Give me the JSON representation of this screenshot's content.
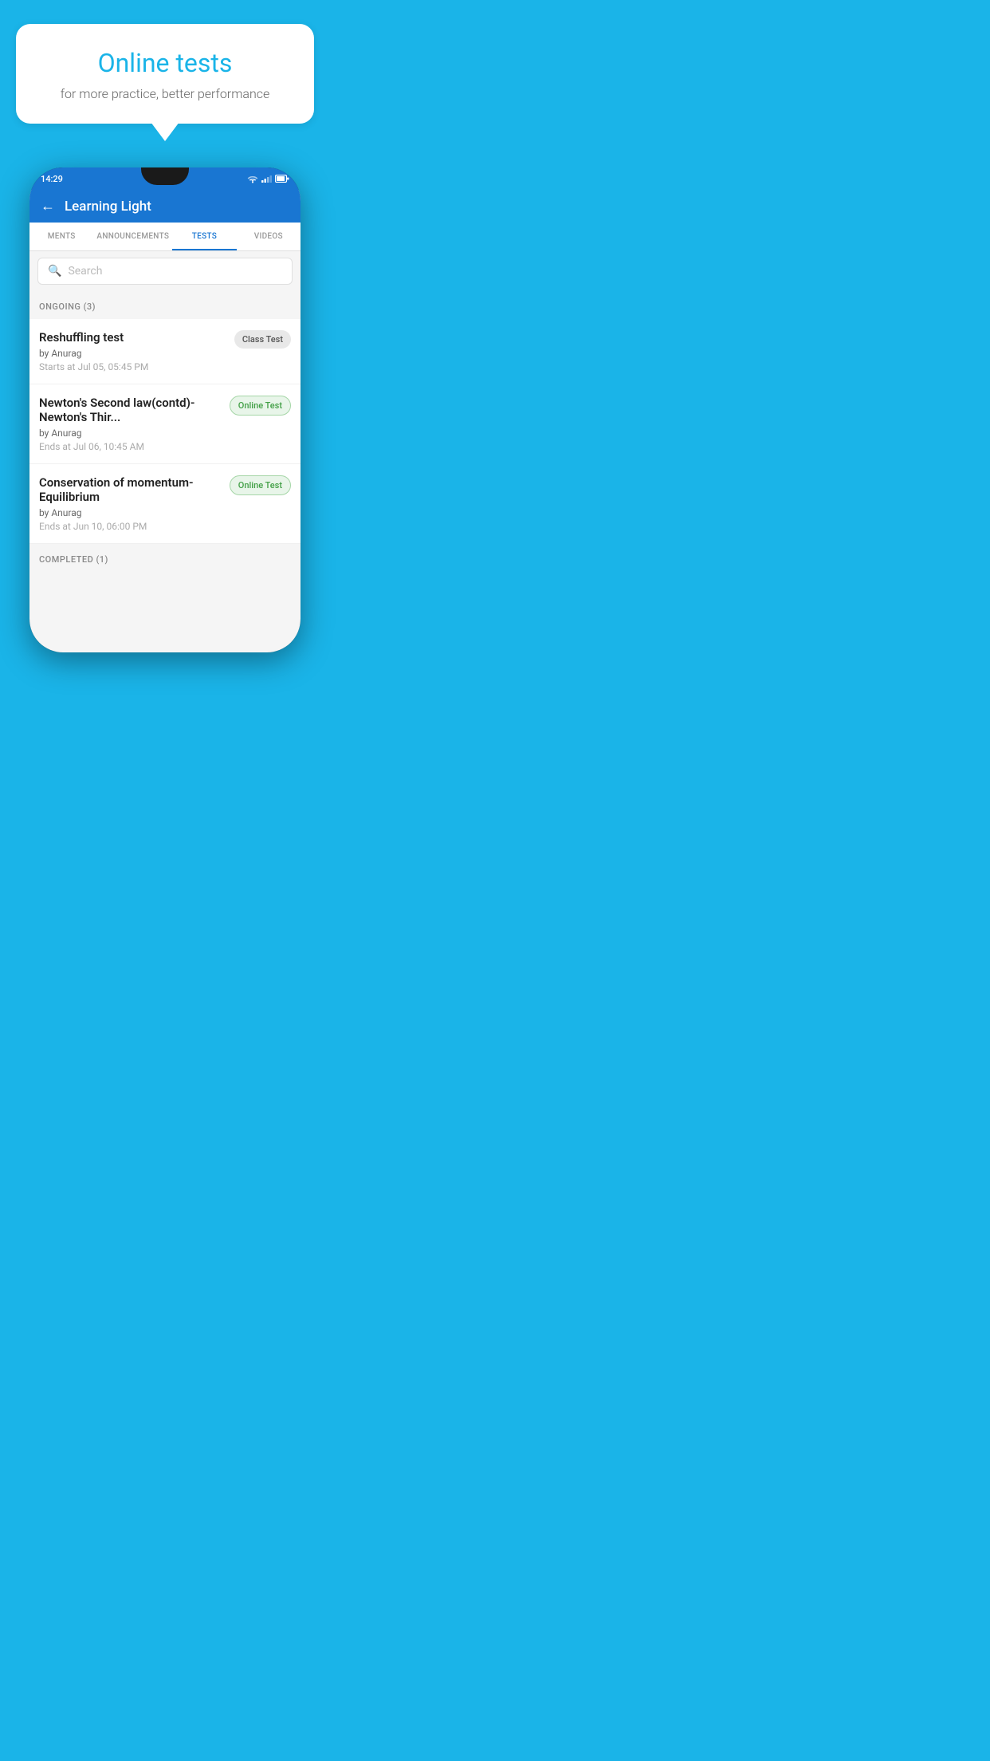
{
  "background_color": "#1ab4e8",
  "speech_bubble": {
    "title": "Online tests",
    "subtitle": "for more practice, better performance"
  },
  "phone": {
    "status_bar": {
      "time": "14:29"
    },
    "header": {
      "title": "Learning Light",
      "back_label": "←"
    },
    "tabs": [
      {
        "label": "MENTS",
        "active": false
      },
      {
        "label": "ANNOUNCEMENTS",
        "active": false
      },
      {
        "label": "TESTS",
        "active": true
      },
      {
        "label": "VIDEOS",
        "active": false
      }
    ],
    "search": {
      "placeholder": "Search"
    },
    "ongoing_section": {
      "label": "ONGOING (3)"
    },
    "tests": [
      {
        "name": "Reshuffling test",
        "author": "by Anurag",
        "time_label": "Starts at",
        "time": "Jul 05, 05:45 PM",
        "badge": "Class Test",
        "badge_type": "class"
      },
      {
        "name": "Newton's Second law(contd)-Newton's Thir...",
        "author": "by Anurag",
        "time_label": "Ends at",
        "time": "Jul 06, 10:45 AM",
        "badge": "Online Test",
        "badge_type": "online"
      },
      {
        "name": "Conservation of momentum-Equilibrium",
        "author": "by Anurag",
        "time_label": "Ends at",
        "time": "Jun 10, 06:00 PM",
        "badge": "Online Test",
        "badge_type": "online"
      }
    ],
    "completed_section": {
      "label": "COMPLETED (1)"
    }
  }
}
